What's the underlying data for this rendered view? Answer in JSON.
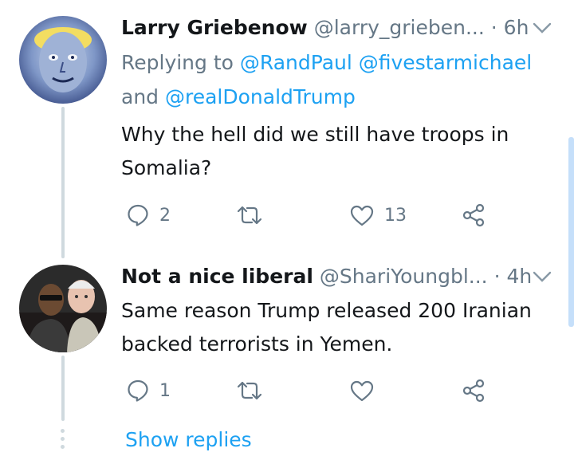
{
  "tweets": [
    {
      "name": "Larry Griebenow",
      "handle": "@larry_grieben...",
      "time": "· 6h",
      "reply_prefix": "Replying to ",
      "reply_mention_1": "@RandPaul",
      "reply_mention_2": "@fivestarmichael",
      "reply_joiner": "and ",
      "reply_mention_3": "@realDonaldTrump",
      "body_line_1": "Why the hell did we still have troops in",
      "body_line_2": "Somalia?",
      "reply_count": "2",
      "retweet_count": "",
      "like_count": "13"
    },
    {
      "name": "Not a nice liberal",
      "handle": "@ShariYoungbl...",
      "time": "· 4h",
      "body_line_1": "Same reason Trump released 200 Iranian",
      "body_line_2": "backed terrorists in Yemen.",
      "reply_count": "1",
      "retweet_count": "",
      "like_count": ""
    }
  ],
  "show_replies_label": "Show replies",
  "icons": {
    "reply": "reply-icon",
    "retweet": "retweet-icon",
    "like": "heart-icon",
    "share": "share-icon",
    "caret": "chevron-down-icon"
  },
  "colors": {
    "link": "#1da1f2",
    "muted": "#657786",
    "text": "#14171a",
    "thread_line": "#cfd9de"
  }
}
